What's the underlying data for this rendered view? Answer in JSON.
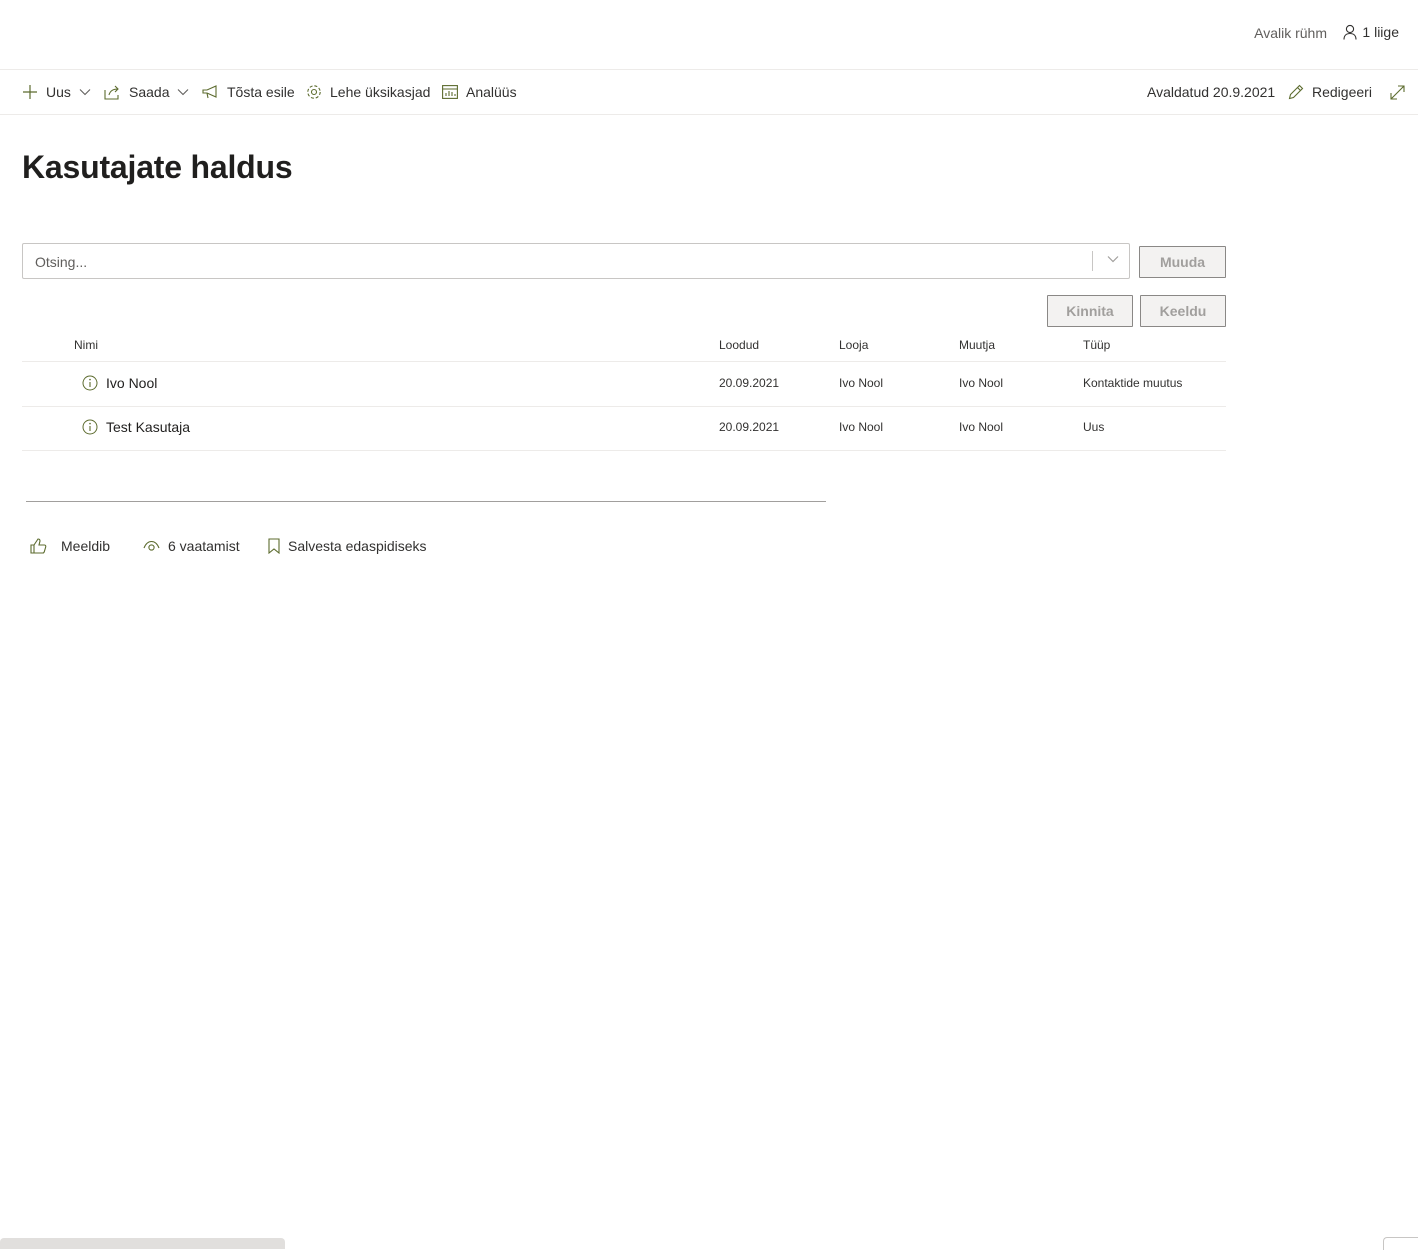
{
  "header": {
    "group_type": "Avalik rühm",
    "members": "1 liige"
  },
  "commandbar": {
    "new_label": "Uus",
    "send_label": "Saada",
    "promote_label": "Tõsta esile",
    "page_details_label": "Lehe üksikasjad",
    "analytics_label": "Analüüs",
    "published": "Avaldatud 20.9.2021",
    "edit_label": "Redigeeri"
  },
  "page": {
    "title": "Kasutajate haldus"
  },
  "search": {
    "placeholder": "Otsing..."
  },
  "buttons": {
    "change": "Muuda",
    "approve": "Kinnita",
    "reject": "Keeldu"
  },
  "table": {
    "headers": {
      "name": "Nimi",
      "created": "Loodud",
      "creator": "Looja",
      "modifier": "Muutja",
      "type": "Tüüp"
    },
    "rows": [
      {
        "name": "Ivo Nool",
        "created": "20.09.2021",
        "creator": "Ivo Nool",
        "modifier": "Ivo Nool",
        "type": "Kontaktide muutus"
      },
      {
        "name": "Test Kasutaja",
        "created": "20.09.2021",
        "creator": "Ivo Nool",
        "modifier": "Ivo Nool",
        "type": "Uus"
      }
    ]
  },
  "social": {
    "like_label": "Meeldib",
    "views": "6 vaatamist",
    "save_label": "Salvesta edaspidiseks"
  },
  "colors": {
    "accent": "#5c6b2e",
    "text": "#323130",
    "border": "#edebe9",
    "disabled_text": "#a19f9d"
  },
  "icons": [
    "person-icon",
    "plus-icon",
    "chevron-down-icon",
    "share-icon",
    "megaphone-icon",
    "gear-icon",
    "analytics-icon",
    "pencil-icon",
    "expand-icon",
    "info-icon",
    "like-icon",
    "eye-icon",
    "bookmark-icon"
  ]
}
